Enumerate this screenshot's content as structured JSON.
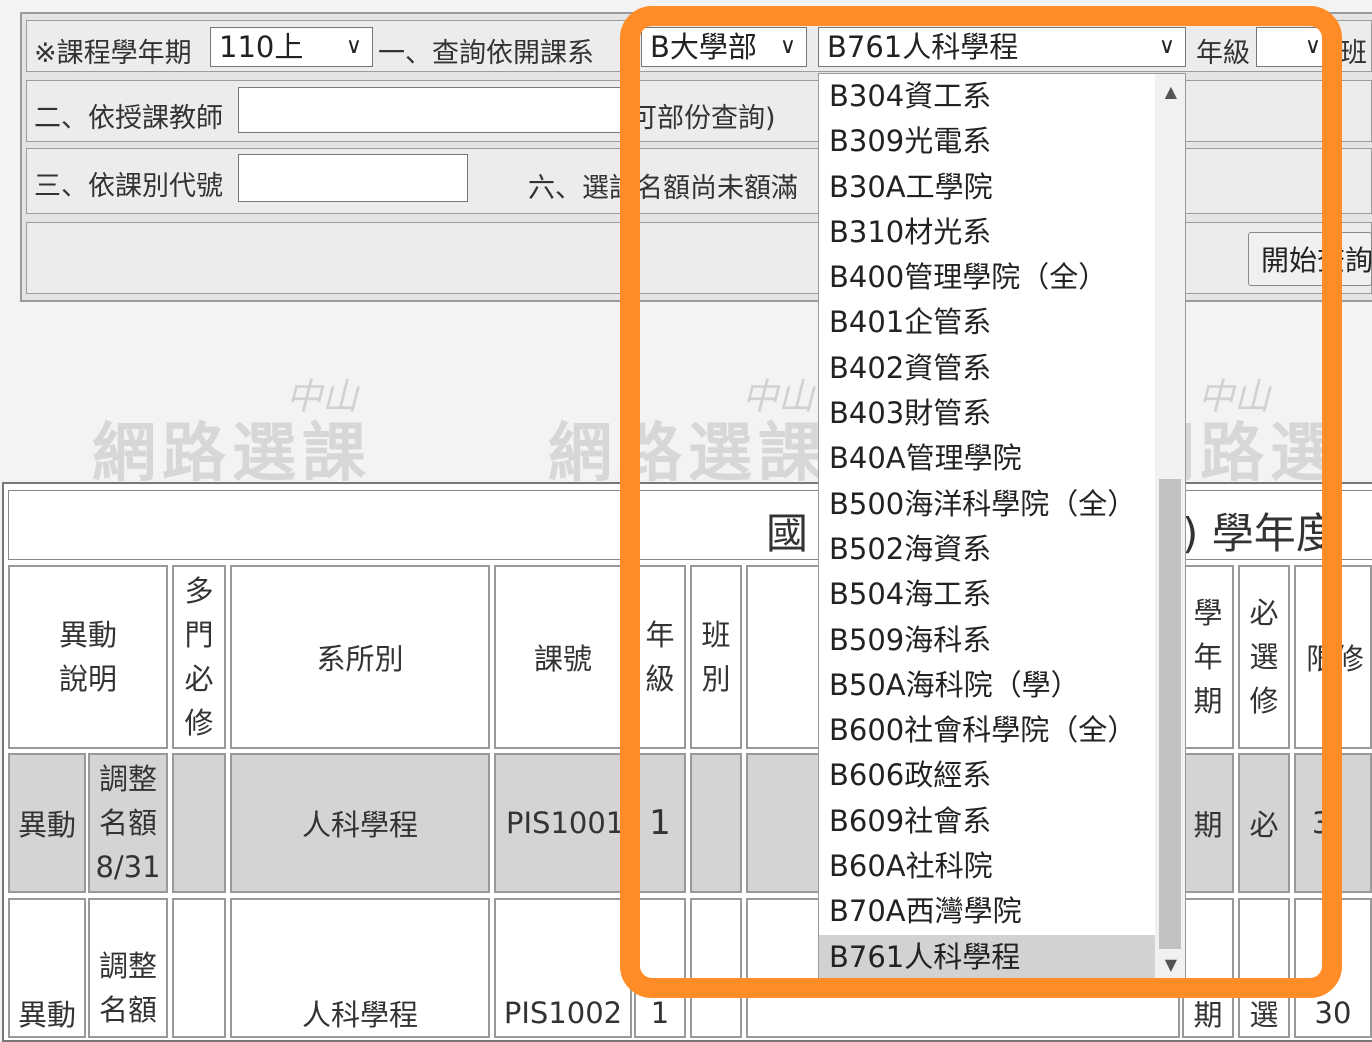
{
  "query": {
    "term_label": "※課程學年期",
    "term_value": "110上",
    "dept_label": "一、查詢依開課系",
    "division_value": "B大學部",
    "dept_value": "B761人科學程",
    "grade_label": "年級",
    "grade_value": "",
    "class_label": "班",
    "teacher_label": "二、依授課教師",
    "teacher_hint": "可部份查詢)",
    "course_code_label": "三、依課別代號",
    "quota_label": "六、選課名額尚未額滿",
    "search_button": "開始查詢"
  },
  "watermark": {
    "text": "網路選課",
    "brand": "中山"
  },
  "table": {
    "title_left": "國",
    "title_right": ") 學年度",
    "headers": {
      "change": [
        "異動",
        "說明"
      ],
      "multi_required": [
        "多",
        "門",
        "必",
        "修"
      ],
      "dept": "系所別",
      "code": "課號",
      "grade": [
        "年",
        "級"
      ],
      "class": [
        "班",
        "別"
      ],
      "term": [
        "學",
        "年",
        "期"
      ],
      "required_elective": [
        "必",
        "選",
        "修"
      ],
      "limit": "限修"
    },
    "rows": [
      {
        "change": "異動",
        "note": [
          "調整",
          "名額",
          "8/31"
        ],
        "dept": "人科學程",
        "code": "PIS1001",
        "grade": "1",
        "term": "期",
        "req": "必",
        "limit": "3"
      },
      {
        "change": "異動",
        "note": [
          "調整",
          "名額"
        ],
        "dept": "人科學程",
        "code": "PIS1002",
        "grade": "1",
        "term": "期",
        "req": "選",
        "limit": "30"
      }
    ]
  },
  "dropdown": {
    "options": [
      "B304資工系",
      "B309光電系",
      "B30A工學院",
      "B310材光系",
      "B400管理學院（全）",
      "B401企管系",
      "B402資管系",
      "B403財管系",
      "B40A管理學院",
      "B500海洋科學院（全）",
      "B502海資系",
      "B504海工系",
      "B509海科系",
      "B50A海科院（學）",
      "B600社會科學院（全）",
      "B606政經系",
      "B609社會系",
      "B60A社科院",
      "B70A西灣學院",
      "B761人科學程"
    ],
    "selected": "B761人科學程"
  },
  "colors": {
    "highlight": "#ff8c26",
    "row_gray": "#d4d4d4"
  }
}
